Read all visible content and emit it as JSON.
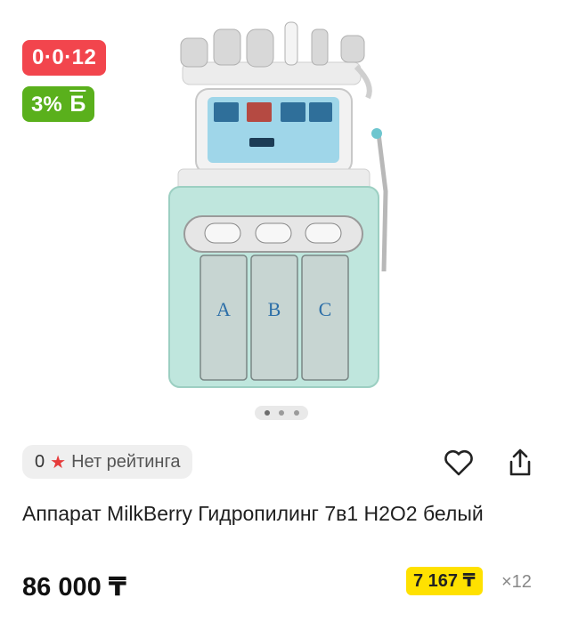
{
  "badges": {
    "installment": "0·0·12",
    "bonus_percent": "3%",
    "bonus_symbol": "Б",
    "installment_color": "#f2454d",
    "bonus_color": "#5ab01c"
  },
  "gallery": {
    "image_icon": "hydrafacial-machine-image",
    "dots_count": 3,
    "active_dot": 0
  },
  "rating": {
    "count": "0",
    "star_icon": "star-icon",
    "label": "Нет рейтинга"
  },
  "actions": {
    "favorite_icon": "heart-icon",
    "share_icon": "share-icon"
  },
  "product": {
    "title": "Аппарат MilkBerry Гидропилинг 7в1 H2O2 белый",
    "price": "86 000 ₸",
    "monthly_payment": "7 167 ₸",
    "months": "×12",
    "monthly_badge_color": "#ffe100"
  }
}
